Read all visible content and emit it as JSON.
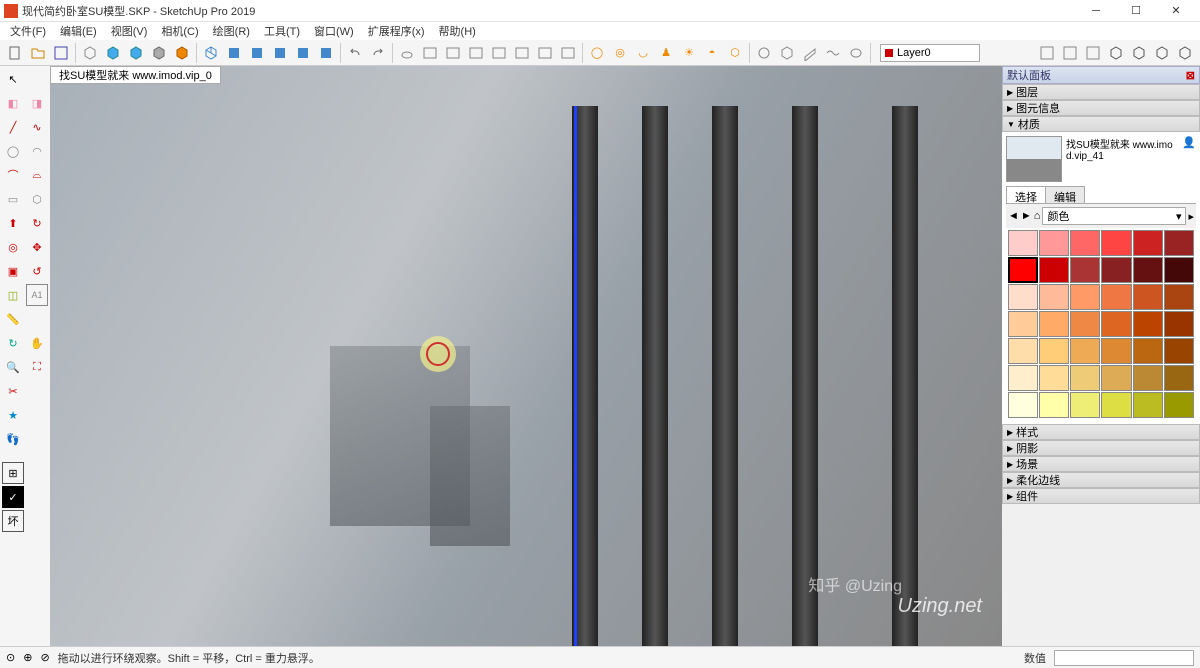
{
  "title": "现代简约卧室SU模型.SKP - SketchUp Pro 2019",
  "menu": [
    "文件(F)",
    "编辑(E)",
    "视图(V)",
    "相机(C)",
    "绘图(R)",
    "工具(T)",
    "窗口(W)",
    "扩展程序(x)",
    "帮助(H)"
  ],
  "layer": "Layer0",
  "viewport_tab": "找SU模型就来 www.imod.vip_0",
  "panel": {
    "header": "默认面板",
    "sections": [
      "图层",
      "图元信息",
      "材质",
      "样式",
      "阴影",
      "场景",
      "柔化边线",
      "组件"
    ],
    "material_name": "找SU模型就来 www.imod.vip_41",
    "tabs": {
      "select": "选择",
      "edit": "编辑"
    },
    "color_label": "颜色"
  },
  "swatches": [
    "#ffcccc",
    "#ff9999",
    "#ff6666",
    "#ff4444",
    "#cc2222",
    "#992222",
    "#ff0000",
    "#cc0000",
    "#aa3333",
    "#882222",
    "#661111",
    "#440808",
    "#ffddcc",
    "#ffbb99",
    "#ff9966",
    "#ee7744",
    "#cc5522",
    "#aa4411",
    "#ffcc99",
    "#ffaa66",
    "#ee8844",
    "#dd6622",
    "#bb4400",
    "#993300",
    "#ffddaa",
    "#ffcc77",
    "#eeaa55",
    "#dd8833",
    "#bb6611",
    "#994400",
    "#ffeecc",
    "#ffdd99",
    "#eecc77",
    "#ddaa55",
    "#bb8833",
    "#996611",
    "#ffffdd",
    "#ffffaa",
    "#eeee77",
    "#dddd44",
    "#bbbb22",
    "#999900"
  ],
  "status": {
    "hint": "拖动以进行环绕观察。Shift = 平移，Ctrl = 重力悬浮。",
    "label": "数值"
  },
  "watermark": "Uzing.net",
  "zhihu": "知乎 @Uzing"
}
